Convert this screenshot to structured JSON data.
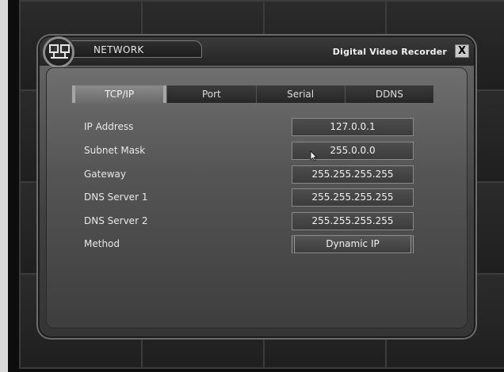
{
  "window": {
    "section_label": "NETWORK",
    "app_title": "Digital Video Recorder",
    "close_label": "X"
  },
  "tabs": [
    {
      "label": "TCP/IP",
      "active": true
    },
    {
      "label": "Port",
      "active": false
    },
    {
      "label": "Serial",
      "active": false
    },
    {
      "label": "DDNS",
      "active": false
    }
  ],
  "form": {
    "ip_address": {
      "label": "IP Address",
      "value": "127.0.0.1"
    },
    "subnet_mask": {
      "label": "Subnet Mask",
      "value": "255.0.0.0"
    },
    "gateway": {
      "label": "Gateway",
      "value": "255.255.255.255"
    },
    "dns1": {
      "label": "DNS Server 1",
      "value": "255.255.255.255"
    },
    "dns2": {
      "label": "DNS Server 2",
      "value": "255.255.255.255"
    },
    "method": {
      "label": "Method",
      "value": "Dynamic IP"
    }
  },
  "icons": {
    "network": "network-icon",
    "close": "close-icon",
    "cursor": "mouse-pointer-icon"
  }
}
